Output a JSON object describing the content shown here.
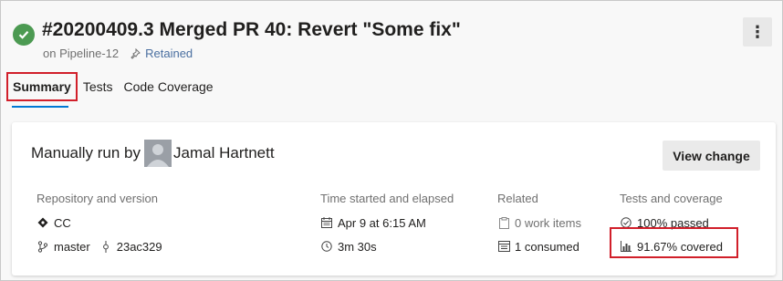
{
  "header": {
    "title": "#20200409.3 Merged PR 40: Revert \"Some fix\"",
    "pipeline": "on Pipeline-12",
    "retained": "Retained",
    "more": "⋮"
  },
  "tabs": [
    {
      "label": "Summary",
      "active": true
    },
    {
      "label": "Tests",
      "active": false
    },
    {
      "label": "Code Coverage",
      "active": false
    }
  ],
  "card": {
    "run_by_label": "Manually run by",
    "user_name": "Jamal Hartnett",
    "view_change": "View change",
    "repo": {
      "header": "Repository and version",
      "repo_name": "CC",
      "branch": "master",
      "commit": "23ac329"
    },
    "time": {
      "header": "Time started and elapsed",
      "started": "Apr 9 at 6:15 AM",
      "elapsed": "3m 30s"
    },
    "related": {
      "header": "Related",
      "work_items": "0 work items",
      "consumed": "1 consumed"
    },
    "tests": {
      "header": "Tests and coverage",
      "passed": "100% passed",
      "covered": "91.67% covered"
    }
  },
  "colors": {
    "success": "#4c9a52",
    "accent": "#0078d4",
    "highlight": "#d11f2a"
  },
  "icons": [
    "check-icon",
    "pin-icon",
    "more-icon",
    "repo-icon",
    "branch-icon",
    "commit-icon",
    "calendar-icon",
    "clock-icon",
    "work-item-icon",
    "artifact-icon",
    "check-circle-icon",
    "coverage-icon"
  ]
}
